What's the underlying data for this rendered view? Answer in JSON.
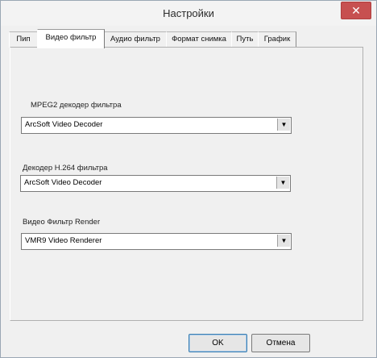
{
  "window": {
    "title": "Настройки"
  },
  "tabs": [
    "Пип",
    "Видео фильтр",
    "Аудио фильтр",
    "Формат снимка",
    "Путь",
    "График"
  ],
  "sections": [
    {
      "label": "MPEG2 декодер фильтра",
      "value": "ArcSoft Video Decoder"
    },
    {
      "label": "Декодер H.264 фильтра",
      "value": "ArcSoft Video Decoder"
    },
    {
      "label": "Видео Фильтр Render",
      "value": "VMR9 Video Renderer"
    }
  ],
  "buttons": {
    "ok": "OK",
    "cancel": "Отмена"
  },
  "icons": {
    "close": "close-icon",
    "dropdown": "chevron-down-icon"
  }
}
